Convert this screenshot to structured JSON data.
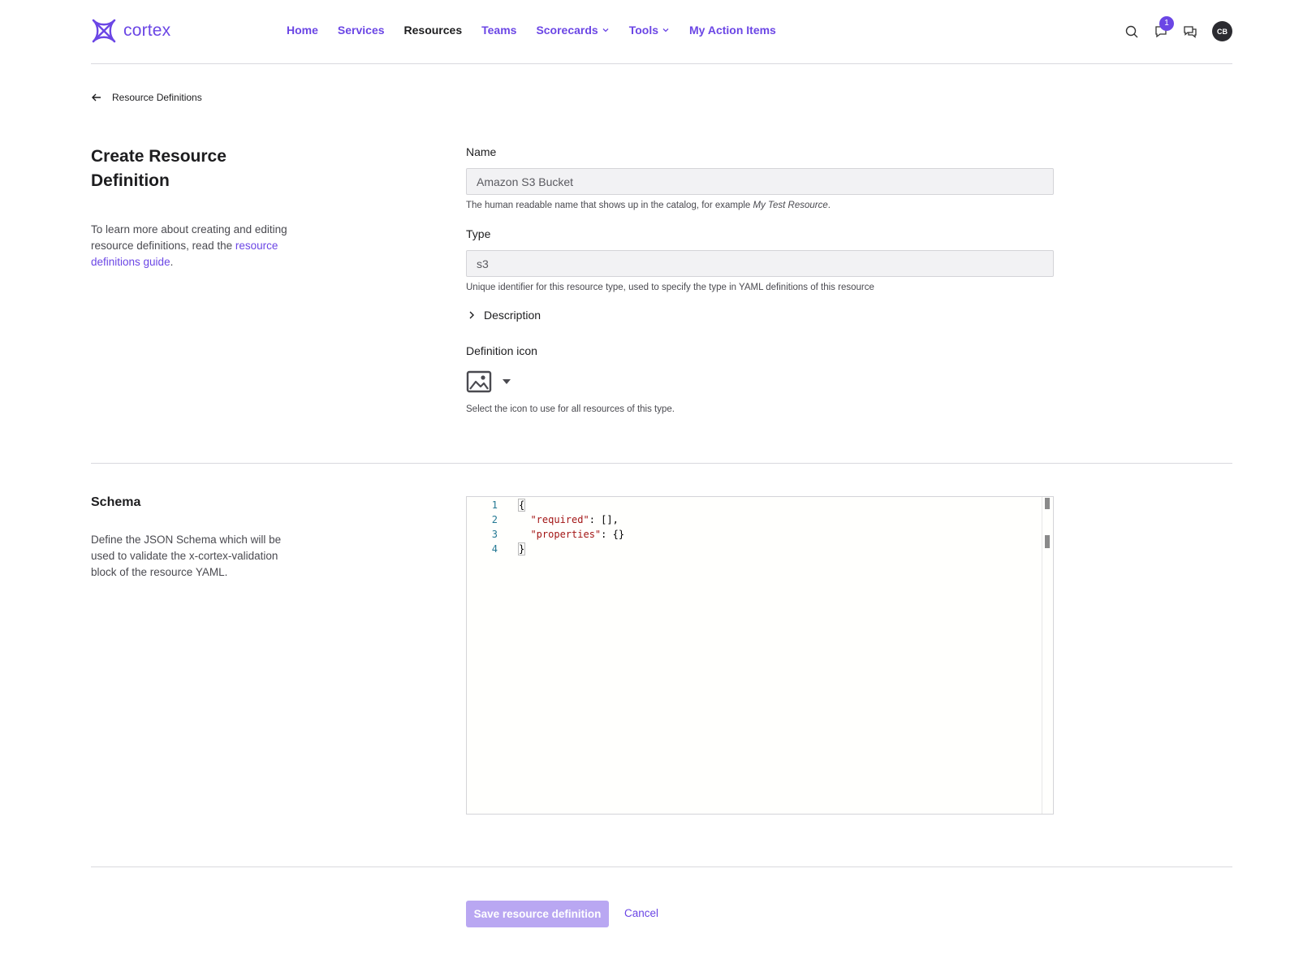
{
  "brand": {
    "name": "cortex",
    "accent": "#6b46e5"
  },
  "nav": {
    "links": [
      {
        "label": "Home"
      },
      {
        "label": "Services"
      },
      {
        "label": "Resources"
      },
      {
        "label": "Teams"
      },
      {
        "label": "Scorecards"
      },
      {
        "label": "Tools"
      },
      {
        "label": "My Action Items"
      }
    ],
    "active": "Resources",
    "notification_count": "1",
    "avatar_initials": "CB",
    "icons": [
      "search-icon",
      "notification-icon",
      "messages-icon"
    ]
  },
  "breadcrumb": {
    "label": "Resource Definitions"
  },
  "page": {
    "title": "Create Resource Definition",
    "intro_text": "To learn more about creating and editing resource definitions, read the ",
    "intro_link": "resource definitions guide",
    "intro_end": "."
  },
  "form": {
    "name": {
      "label": "Name",
      "value": "Amazon S3 Bucket",
      "help_prefix": "The human readable name that shows up in the catalog, for example ",
      "help_example": "My Test Resource",
      "help_suffix": "."
    },
    "type": {
      "label": "Type",
      "value": "s3",
      "help": "Unique identifier for this resource type, used to specify the type in YAML definitions of this resource"
    },
    "description_label": "Description",
    "icon": {
      "label": "Definition icon",
      "selected": "image-icon",
      "help": "Select the icon to use for all resources of this type."
    }
  },
  "schema": {
    "title": "Schema",
    "description": "Define the JSON Schema which will be used to validate the x-cortex-validation block of the resource YAML.",
    "code_lines": [
      {
        "num": "1",
        "text": "{"
      },
      {
        "num": "2",
        "key": "\"required\"",
        "rest": ": [],"
      },
      {
        "num": "3",
        "key": "\"properties\"",
        "rest": ": {}"
      },
      {
        "num": "4",
        "text": "}"
      }
    ]
  },
  "actions": {
    "save_label": "Save resource definition",
    "cancel_label": "Cancel"
  }
}
